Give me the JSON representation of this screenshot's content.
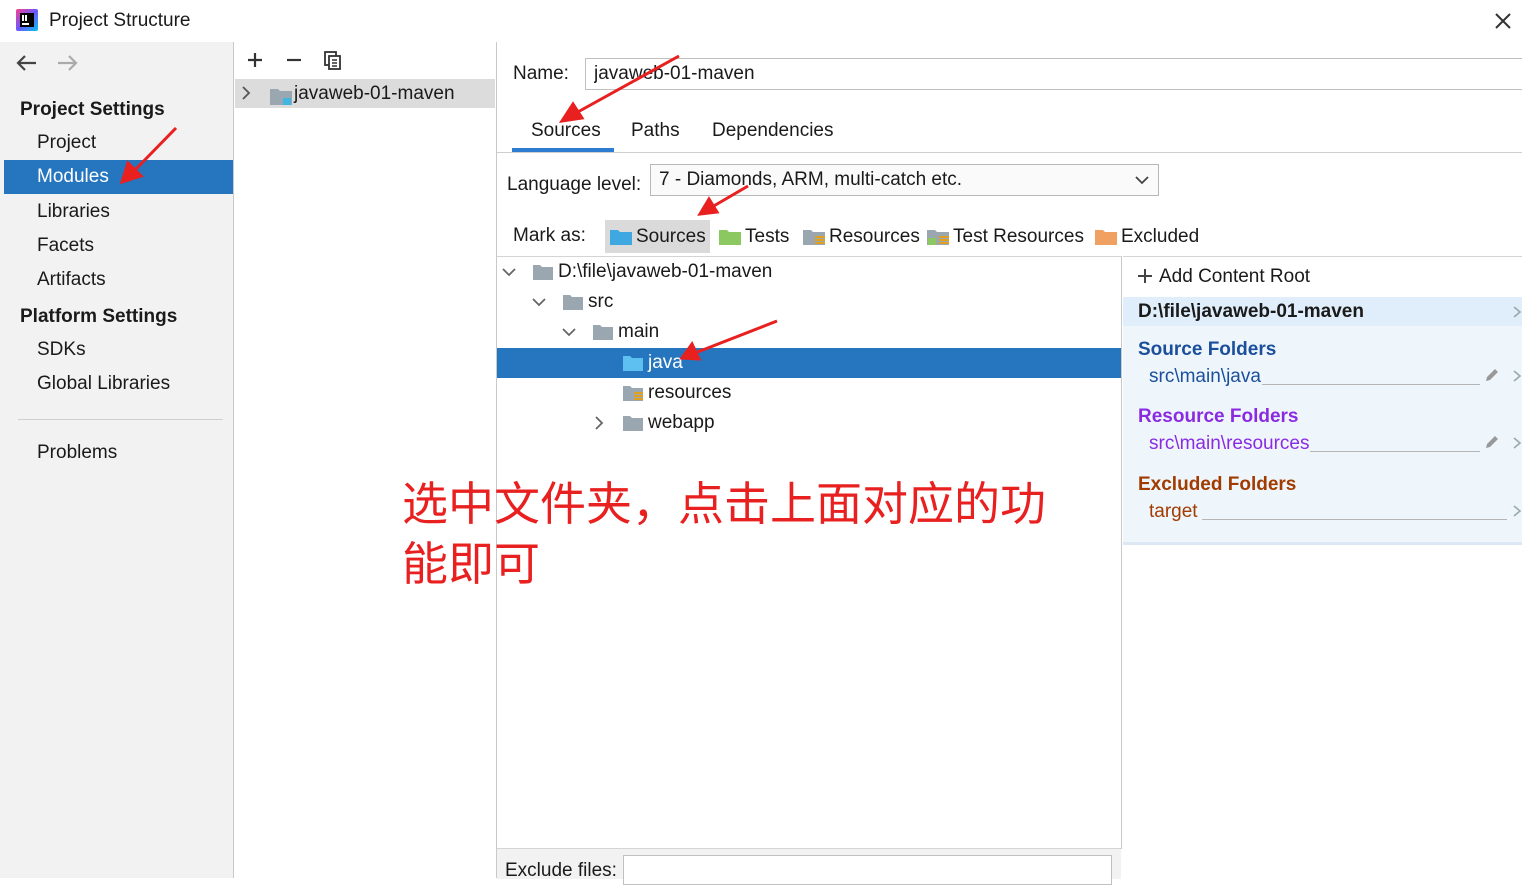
{
  "window": {
    "title": "Project Structure"
  },
  "colors": {
    "accent": "#2675bf",
    "source_folder": "#1b4f9c",
    "resource_folder": "#8a2be2",
    "excluded_folder": "#a23b00",
    "annotation": "#e82020"
  },
  "sidebar": {
    "project_settings_heading": "Project Settings",
    "platform_settings_heading": "Platform Settings",
    "items": [
      {
        "label": "Project"
      },
      {
        "label": "Modules",
        "selected": true
      },
      {
        "label": "Libraries"
      },
      {
        "label": "Facets"
      },
      {
        "label": "Artifacts"
      },
      {
        "label": "SDKs"
      },
      {
        "label": "Global Libraries"
      },
      {
        "label": "Problems"
      }
    ]
  },
  "modules": {
    "items": [
      {
        "label": "javaweb-01-maven"
      }
    ]
  },
  "module": {
    "name_label": "Name:",
    "name_value": "javaweb-01-maven",
    "tabs": [
      {
        "label": "Sources",
        "active": true
      },
      {
        "label": "Paths"
      },
      {
        "label": "Dependencies"
      }
    ],
    "language_level_label": "Language level:",
    "language_level_value": "7 - Diamonds, ARM, multi-catch etc.",
    "mark_as_label": "Mark as:",
    "mark_as": [
      {
        "label": "Sources",
        "icon": "source-folder-icon"
      },
      {
        "label": "Tests",
        "icon": "test-folder-icon"
      },
      {
        "label": "Resources",
        "icon": "resources-folder-icon"
      },
      {
        "label": "Test Resources",
        "icon": "test-resources-folder-icon"
      },
      {
        "label": "Excluded",
        "icon": "excluded-folder-icon"
      }
    ],
    "tree": [
      {
        "label": "D:\\file\\javaweb-01-maven",
        "expanded": true
      },
      {
        "label": "src",
        "expanded": true
      },
      {
        "label": "main",
        "expanded": true
      },
      {
        "label": "java",
        "selected": true
      },
      {
        "label": "resources"
      },
      {
        "label": "webapp",
        "expanded": false
      }
    ],
    "exclude_files_label": "Exclude files:",
    "exclude_files_value": ""
  },
  "content_roots": {
    "add_label": "Add Content Root",
    "root_path": "D:\\file\\javaweb-01-maven",
    "source_heading": "Source Folders",
    "source_items": [
      "src\\main\\java"
    ],
    "resource_heading": "Resource Folders",
    "resource_items": [
      "src\\main\\resources"
    ],
    "excluded_heading": "Excluded Folders",
    "excluded_items": [
      "target"
    ]
  },
  "annotation": {
    "line1": "选中文件夹，点击上面对应的功",
    "line2": "能即可"
  }
}
